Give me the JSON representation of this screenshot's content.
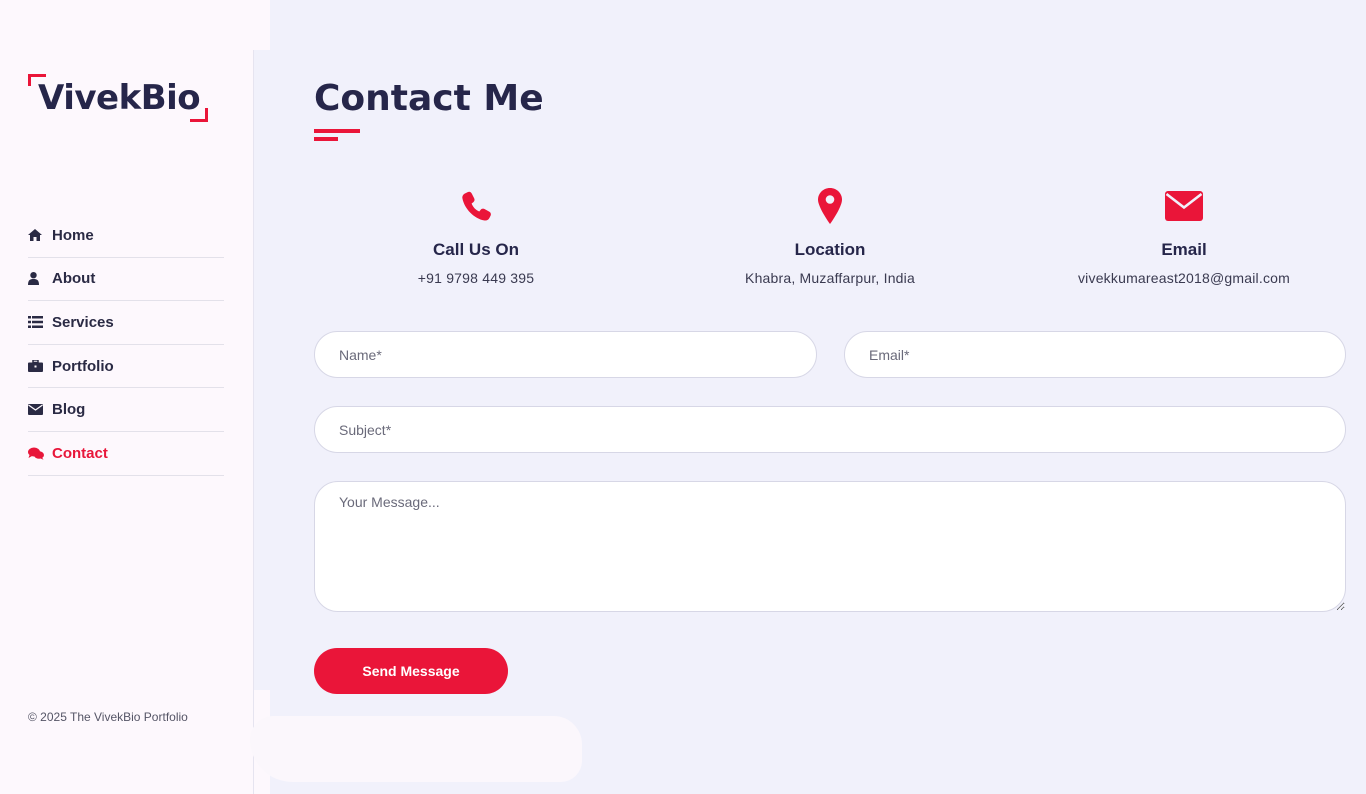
{
  "brand": {
    "logo_text": "VivekBio",
    "accent": "#ea1539"
  },
  "sidebar": {
    "items": [
      {
        "label": "Home",
        "icon": "home-icon",
        "active": false
      },
      {
        "label": "About",
        "icon": "user-icon",
        "active": false
      },
      {
        "label": "Services",
        "icon": "list-icon",
        "active": false
      },
      {
        "label": "Portfolio",
        "icon": "briefcase-icon",
        "active": false
      },
      {
        "label": "Blog",
        "icon": "envelope-icon",
        "active": false
      },
      {
        "label": "Contact",
        "icon": "comments-icon",
        "active": true
      }
    ],
    "copyright": "© 2025 The VivekBio Portfolio"
  },
  "main": {
    "title": "Contact Me",
    "info": [
      {
        "title": "Call Us On",
        "value": "+91 9798 449 395",
        "icon": "phone-icon"
      },
      {
        "title": "Location",
        "value": "Khabra, Muzaffarpur, India",
        "icon": "map-marker-icon"
      },
      {
        "title": "Email",
        "value": "vivekkumareast2018@gmail.com",
        "icon": "envelope-icon"
      }
    ],
    "form": {
      "name_placeholder": "Name*",
      "email_placeholder": "Email*",
      "subject_placeholder": "Subject*",
      "message_placeholder": "Your Message...",
      "submit_label": "Send Message"
    }
  }
}
